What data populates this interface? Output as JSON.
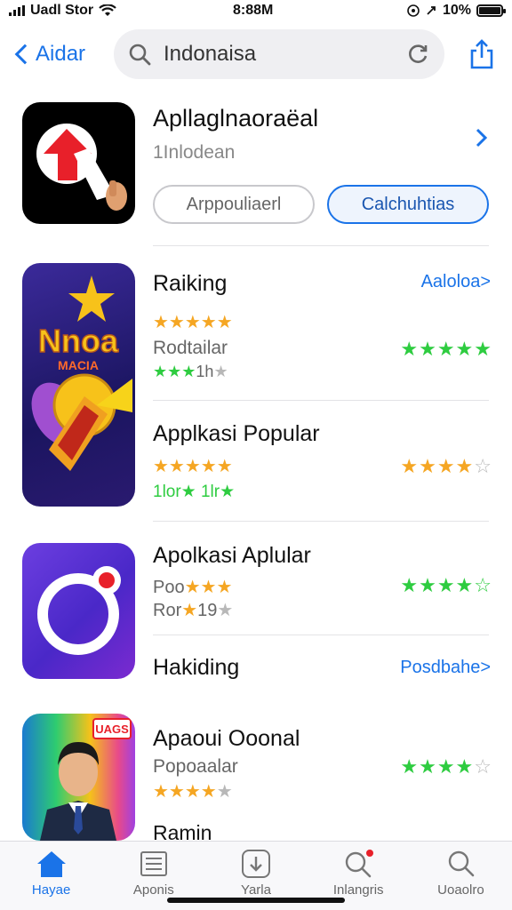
{
  "status_bar": {
    "carrier": "Uadl Stor",
    "time": "8:88M",
    "battery": "10%"
  },
  "nav": {
    "back_label": "Aidar",
    "search_value": "Indonaisa"
  },
  "featured": {
    "title": "Apllaglnaoraëal",
    "subtitle": "1Inlodean",
    "button_left": "Arppouliaerl",
    "button_right": "Calchuhtias"
  },
  "section1": {
    "heading": "Raiking",
    "link": "Aaloloa>",
    "icon_text_main": "Nnoa",
    "icon_text_sub": "MACIA",
    "sub_label": "Rodtailar",
    "sub_rating": "1h",
    "item_title": "Applkasi Popular",
    "item_subline": "1lor★ 1lr★"
  },
  "section2": {
    "title": "Apolkasi Aplular",
    "line1": "Poo",
    "line2": "Ror",
    "line2_number": "19"
  },
  "section2b": {
    "heading": "Hakiding",
    "link": "Posdbahe>"
  },
  "section3": {
    "title": "Apaoui Ooonal",
    "subtitle": "Popoaalar",
    "badge": "UAGS",
    "cut_label": "Ramin"
  },
  "tabs": [
    {
      "label": "Hayae",
      "icon": "home-icon"
    },
    {
      "label": "Aponis",
      "icon": "list-icon"
    },
    {
      "label": "Yarla",
      "icon": "download-icon"
    },
    {
      "label": "Inlangris",
      "icon": "search-badge-icon"
    },
    {
      "label": "Uoaolro",
      "icon": "search-icon"
    }
  ],
  "colors": {
    "accent": "#1a73e8",
    "star_orange": "#f5a623",
    "star_green": "#2ecc40",
    "star_gray": "#b8b8b8"
  }
}
